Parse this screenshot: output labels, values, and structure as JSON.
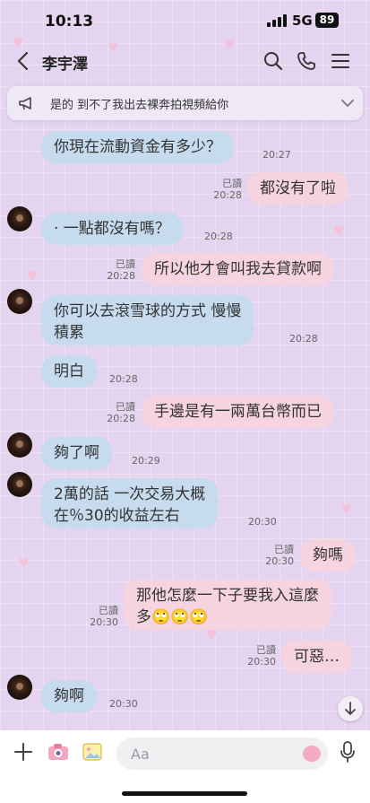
{
  "status": {
    "time": "10:13",
    "network": "5G",
    "battery": "89"
  },
  "header": {
    "name": "李宇澤"
  },
  "announcement": {
    "text": "是的 到不了我出去裸奔拍視頻給你"
  },
  "messages": [
    {
      "side": "in",
      "text": "你現在流動資金有多少？",
      "time": "20:27"
    },
    {
      "side": "out",
      "text": "都沒有了啦",
      "read": "已讀",
      "time": "20:28"
    },
    {
      "side": "in",
      "text": "· 一點都沒有嗎？",
      "time": "20:28"
    },
    {
      "side": "out",
      "text": "所以他才會叫我去貸款啊",
      "read": "已讀",
      "time": "20:28"
    },
    {
      "side": "in",
      "lines": [
        "你可以去滾雪球的方式  慢慢",
        "積累"
      ],
      "time": "20:28"
    },
    {
      "side": "in",
      "text": "明白",
      "time": "20:28"
    },
    {
      "side": "out",
      "text": "手邊是有一兩萬台幣而已",
      "read": "已讀",
      "time": "20:28"
    },
    {
      "side": "in",
      "text": "夠了啊",
      "time": "20:29"
    },
    {
      "side": "in",
      "lines": [
        "2萬的話  一次交易大概",
        "在％30的收益左右"
      ],
      "time": "20:30"
    },
    {
      "side": "out",
      "text": "夠嗎",
      "read": "已讀",
      "time": "20:30"
    },
    {
      "side": "out",
      "lines": [
        "那他怎麼一下子要我入這麼",
        "多🙄🙄🙄"
      ],
      "read": "已讀",
      "time": "20:30"
    },
    {
      "side": "out",
      "text": "可惡…",
      "read": "已讀",
      "time": "20:30"
    },
    {
      "side": "in",
      "text": "夠啊",
      "time": "20:30"
    }
  ],
  "input": {
    "placeholder": "Aa"
  },
  "icons": [
    "back-arrow-icon",
    "search-icon",
    "phone-icon",
    "menu-icon",
    "megaphone-icon",
    "chevron-down-icon",
    "arrow-down-icon",
    "plus-icon",
    "camera-icon",
    "image-icon",
    "sticker-icon",
    "microphone-icon"
  ],
  "colors": {
    "incoming_bubble": "#c7dbef",
    "outgoing_bubble": "#f5d4df",
    "background": "#e4d4ef"
  }
}
